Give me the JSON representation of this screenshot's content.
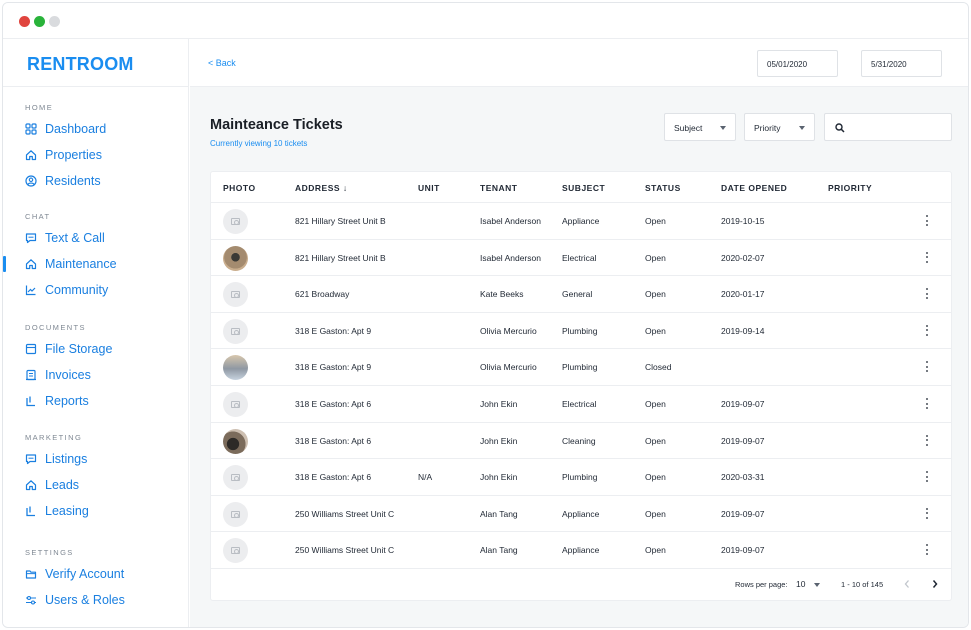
{
  "brand": "RENTROOM",
  "sidebar": {
    "sections": [
      {
        "title": "HOME",
        "items": [
          {
            "label": "Dashboard",
            "icon": "grid-icon"
          },
          {
            "label": "Properties",
            "icon": "home-icon"
          },
          {
            "label": "Residents",
            "icon": "person-icon"
          }
        ]
      },
      {
        "title": "CHAT",
        "items": [
          {
            "label": "Text & Call",
            "icon": "chat-icon"
          },
          {
            "label": "Maintenance",
            "icon": "home-icon",
            "active": true
          },
          {
            "label": "Community",
            "icon": "chart-icon"
          }
        ]
      },
      {
        "title": "DOCUMENTS",
        "items": [
          {
            "label": "File Storage",
            "icon": "file-icon"
          },
          {
            "label": "Invoices",
            "icon": "invoice-icon"
          },
          {
            "label": "Reports",
            "icon": "report-icon"
          }
        ]
      },
      {
        "title": "MARKETING",
        "items": [
          {
            "label": "Listings",
            "icon": "chat-icon"
          },
          {
            "label": "Leads",
            "icon": "home-icon"
          },
          {
            "label": "Leasing",
            "icon": "report-icon"
          }
        ]
      },
      {
        "title": "SETTINGS",
        "items": [
          {
            "label": "Verify Account",
            "icon": "folder-icon"
          },
          {
            "label": "Users & Roles",
            "icon": "sliders-icon"
          }
        ]
      }
    ]
  },
  "topbar": {
    "back_label": "< Back",
    "date_from": "05/01/2020",
    "date_to": "5/31/2020"
  },
  "page": {
    "title": "Mainteance Tickets",
    "subtitle": "Currently viewing 10 tickets"
  },
  "filters": {
    "subject_label": "Subject",
    "priority_label": "Priority"
  },
  "table": {
    "headers": [
      "PHOTO",
      "ADDRESS ↓",
      "UNIT",
      "TENANT",
      "SUBJECT",
      "STATUS",
      "DATE OPENED",
      "PRIORITY"
    ],
    "rows": [
      {
        "photo": "placeholder",
        "address": "821 Hillary Street Unit B",
        "unit": "",
        "tenant": "Isabel Anderson",
        "subject": "Appliance",
        "status": "Open",
        "date": "2019-10-15"
      },
      {
        "photo": "img1",
        "address": "821 Hillary Street Unit B",
        "unit": "",
        "tenant": "Isabel Anderson",
        "subject": "Electrical",
        "status": "Open",
        "date": "2020-02-07"
      },
      {
        "photo": "placeholder",
        "address": "621 Broadway",
        "unit": "",
        "tenant": "Kate Beeks",
        "subject": "General",
        "status": "Open",
        "date": "2020-01-17"
      },
      {
        "photo": "placeholder",
        "address": "318 E Gaston: Apt 9",
        "unit": "",
        "tenant": "Olivia Mercurio",
        "subject": "Plumbing",
        "status": "Open",
        "date": "2019-09-14"
      },
      {
        "photo": "img2",
        "address": "318 E Gaston: Apt 9",
        "unit": "",
        "tenant": "Olivia Mercurio",
        "subject": "Plumbing",
        "status": "Closed",
        "date": ""
      },
      {
        "photo": "placeholder",
        "address": "318 E Gaston: Apt 6",
        "unit": "",
        "tenant": "John Ekin",
        "subject": "Electrical",
        "status": "Open",
        "date": "2019-09-07"
      },
      {
        "photo": "img3",
        "address": "318 E Gaston: Apt 6",
        "unit": "",
        "tenant": "John Ekin",
        "subject": "Cleaning",
        "status": "Open",
        "date": "2019-09-07"
      },
      {
        "photo": "placeholder",
        "address": "318 E Gaston: Apt 6",
        "unit": "N/A",
        "tenant": "John Ekin",
        "subject": "Plumbing",
        "status": "Open",
        "date": "2020-03-31"
      },
      {
        "photo": "placeholder",
        "address": "250 Williams Street Unit C",
        "unit": "",
        "tenant": "Alan Tang",
        "subject": "Appliance",
        "status": "Open",
        "date": "2019-09-07"
      },
      {
        "photo": "placeholder",
        "address": "250 Williams Street Unit C",
        "unit": "",
        "tenant": "Alan Tang",
        "subject": "Appliance",
        "status": "Open",
        "date": "2019-09-07"
      }
    ]
  },
  "pagination": {
    "rows_per_page_label": "Rows per page:",
    "rows_per_page_value": "10",
    "range_label": "1 - 10 of 145"
  },
  "colors": {
    "accent": "#1a8df0"
  }
}
